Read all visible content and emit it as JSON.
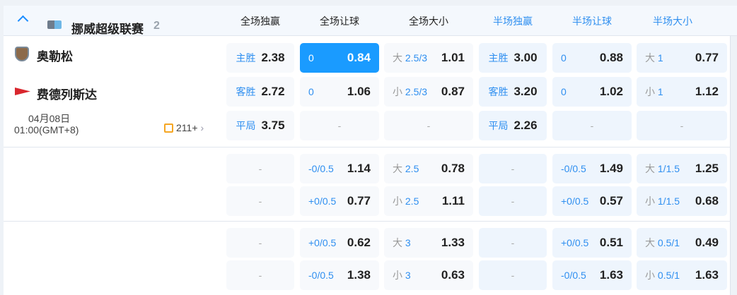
{
  "league": {
    "name": "挪威超级联赛",
    "count": "2"
  },
  "columns": [
    "全场独赢",
    "全场让球",
    "全场大小",
    "半场独赢",
    "半场让球",
    "半场大小"
  ],
  "match": {
    "home": "奥勒松",
    "away": "费德列斯达",
    "date": "04月08日",
    "time": "01:00(GMT+8)",
    "markets_count": "211+"
  },
  "colors": {
    "accent": "#1a9bff",
    "selected": "#1a9bff"
  },
  "rows": [
    [
      {
        "l": "主胜",
        "o": "2.38"
      },
      {
        "l": "0",
        "o": "0.84",
        "selected": true
      },
      {
        "p": "大",
        "l": "2.5/3",
        "o": "1.01"
      },
      {
        "l": "主胜",
        "o": "3.00"
      },
      {
        "l": "0",
        "o": "0.88"
      },
      {
        "p": "大",
        "l": "1",
        "o": "0.77"
      }
    ],
    [
      {
        "l": "客胜",
        "o": "2.72"
      },
      {
        "l": "0",
        "o": "1.06"
      },
      {
        "p": "小",
        "l": "2.5/3",
        "o": "0.87"
      },
      {
        "l": "客胜",
        "o": "3.20"
      },
      {
        "l": "0",
        "o": "1.02"
      },
      {
        "p": "小",
        "l": "1",
        "o": "1.12"
      }
    ],
    [
      {
        "l": "平局",
        "o": "3.75"
      },
      {
        "d": "-"
      },
      {
        "d": "-"
      },
      {
        "l": "平局",
        "o": "2.26"
      },
      {
        "d": "-"
      },
      {
        "d": "-"
      }
    ],
    [
      {
        "d": "-"
      },
      {
        "l": "-0/0.5",
        "o": "1.14"
      },
      {
        "p": "大",
        "l": "2.5",
        "o": "0.78"
      },
      {
        "d": "-"
      },
      {
        "l": "-0/0.5",
        "o": "1.49"
      },
      {
        "p": "大",
        "l": "1/1.5",
        "o": "1.25"
      }
    ],
    [
      {
        "d": "-"
      },
      {
        "l": "+0/0.5",
        "o": "0.77"
      },
      {
        "p": "小",
        "l": "2.5",
        "o": "1.11"
      },
      {
        "d": "-"
      },
      {
        "l": "+0/0.5",
        "o": "0.57"
      },
      {
        "p": "小",
        "l": "1/1.5",
        "o": "0.68"
      }
    ],
    [
      {
        "d": "-"
      },
      {
        "l": "+0/0.5",
        "o": "0.62"
      },
      {
        "p": "大",
        "l": "3",
        "o": "1.33"
      },
      {
        "d": "-"
      },
      {
        "l": "+0/0.5",
        "o": "0.51"
      },
      {
        "p": "大",
        "l": "0.5/1",
        "o": "0.49"
      }
    ],
    [
      {
        "d": "-"
      },
      {
        "l": "-0/0.5",
        "o": "1.38"
      },
      {
        "p": "小",
        "l": "3",
        "o": "0.63"
      },
      {
        "d": "-"
      },
      {
        "l": "-0/0.5",
        "o": "1.63"
      },
      {
        "p": "小",
        "l": "0.5/1",
        "o": "1.63"
      }
    ]
  ]
}
